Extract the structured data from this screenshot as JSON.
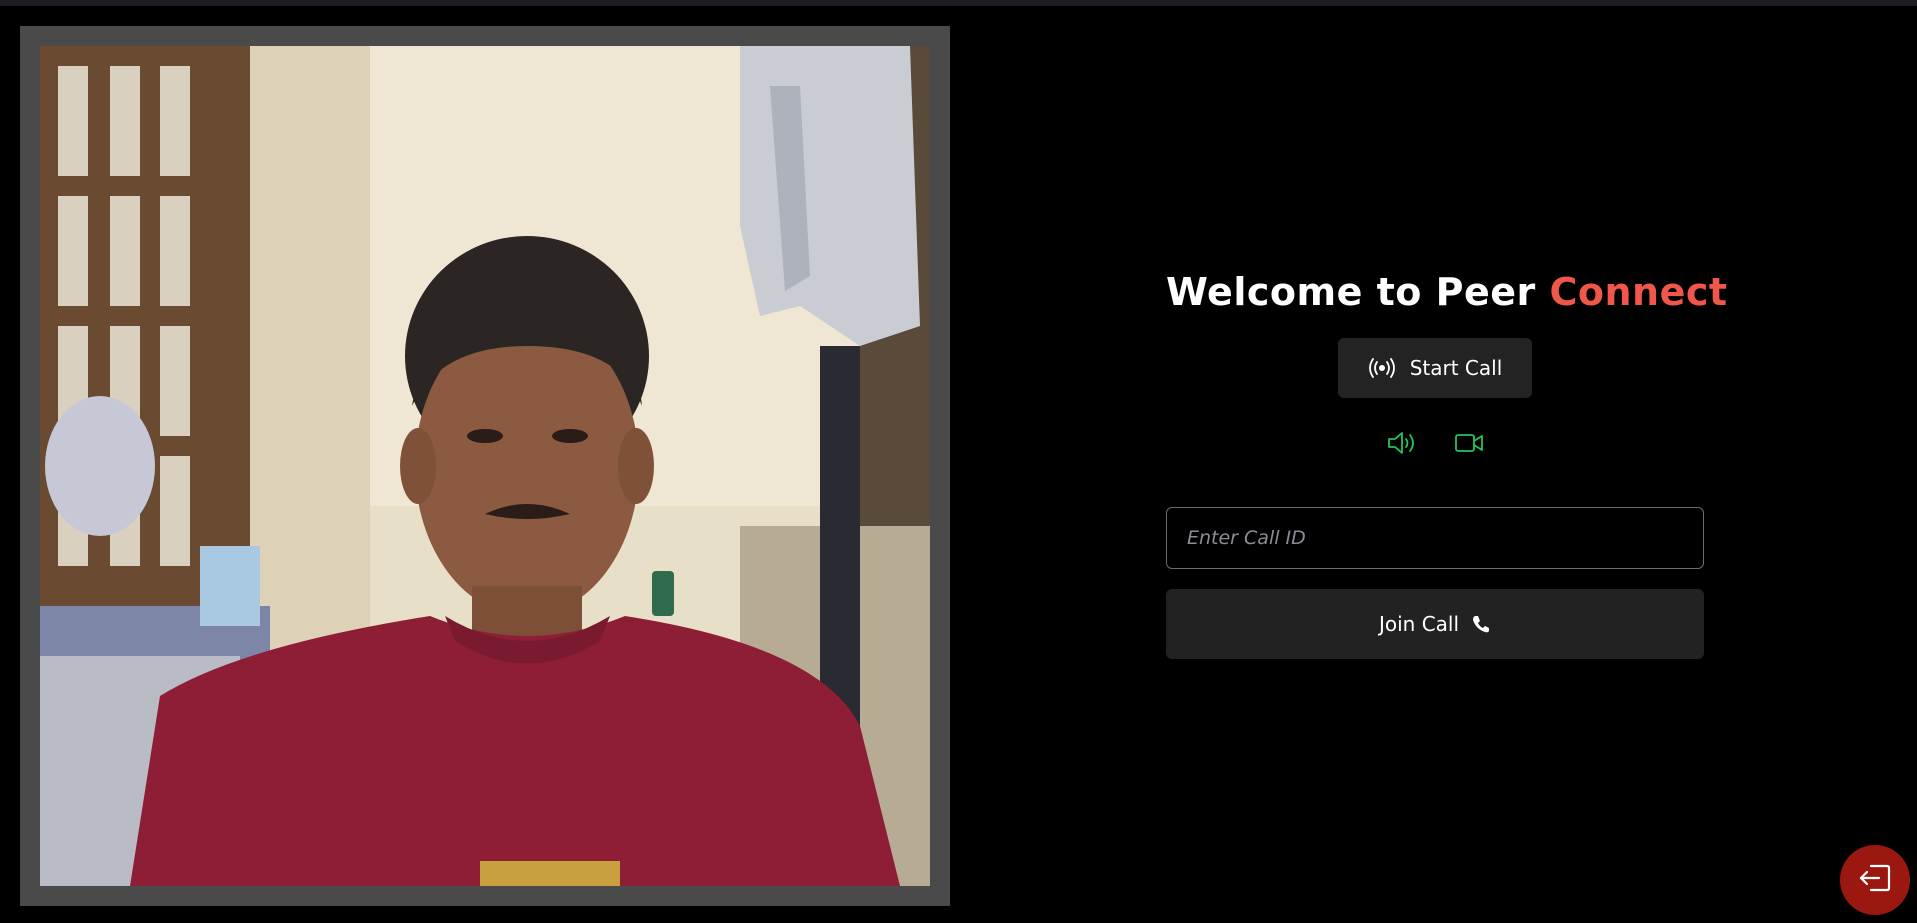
{
  "app": {
    "title_main": "Welcome to Peer ",
    "title_accent": "Connect",
    "accent_color": "#f0574a"
  },
  "actions": {
    "start_call_label": "Start Call",
    "start_call_icon": "broadcast-icon",
    "join_call_label": "Join Call",
    "join_call_icon": "phone-icon"
  },
  "media_toggles": [
    {
      "name": "speaker-icon",
      "color": "#22c55e"
    },
    {
      "name": "video-camera-icon",
      "color": "#22c55e"
    }
  ],
  "call_id_input": {
    "placeholder": "Enter Call ID",
    "value": ""
  },
  "leave_button": {
    "icon": "exit-icon",
    "color": "#9b1810"
  },
  "video_feed": {
    "kind": "local-camera-preview"
  }
}
